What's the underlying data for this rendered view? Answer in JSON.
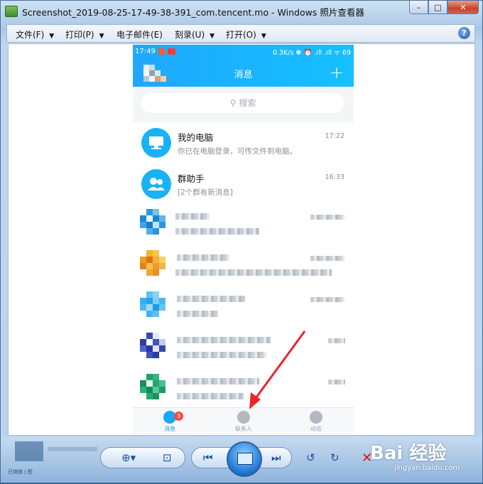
{
  "window": {
    "title": "Screenshot_2019-08-25-17-49-38-391_com.tencent.mo - Windows 照片查看器",
    "buttons": {
      "minimize": "–",
      "maximize": "□",
      "close": "✕"
    }
  },
  "menu": {
    "items": [
      {
        "label": "文件(F)"
      },
      {
        "label": "打印(P)"
      },
      {
        "label": "电子邮件(E)"
      },
      {
        "label": "刻录(U)"
      },
      {
        "label": "打开(O)"
      }
    ],
    "help": "?"
  },
  "phone": {
    "status_time": "17:49",
    "status_right": "0.3K/s ✱ ⏰ .ıll .ıll ᯤ 69",
    "header_title": "消息",
    "plus": "+",
    "search_placeholder": "搜索",
    "chats": [
      {
        "name": "我的电脑",
        "message": "你已在电脑登录，可传文件到电脑。",
        "time": "17:22",
        "icon": "computer-icon"
      },
      {
        "name": "群助手",
        "message": "[2个群有新消息]",
        "time": "16:33",
        "icon": "group-icon"
      }
    ],
    "tabs": [
      {
        "label": "消息",
        "badge": "3"
      },
      {
        "label": "联系人"
      },
      {
        "label": "动态"
      }
    ]
  },
  "toolbar": {
    "status_small": "已缩放 | 图"
  },
  "watermark": {
    "main": "Bai 经验",
    "sub": "jingyan.baidu.com"
  }
}
